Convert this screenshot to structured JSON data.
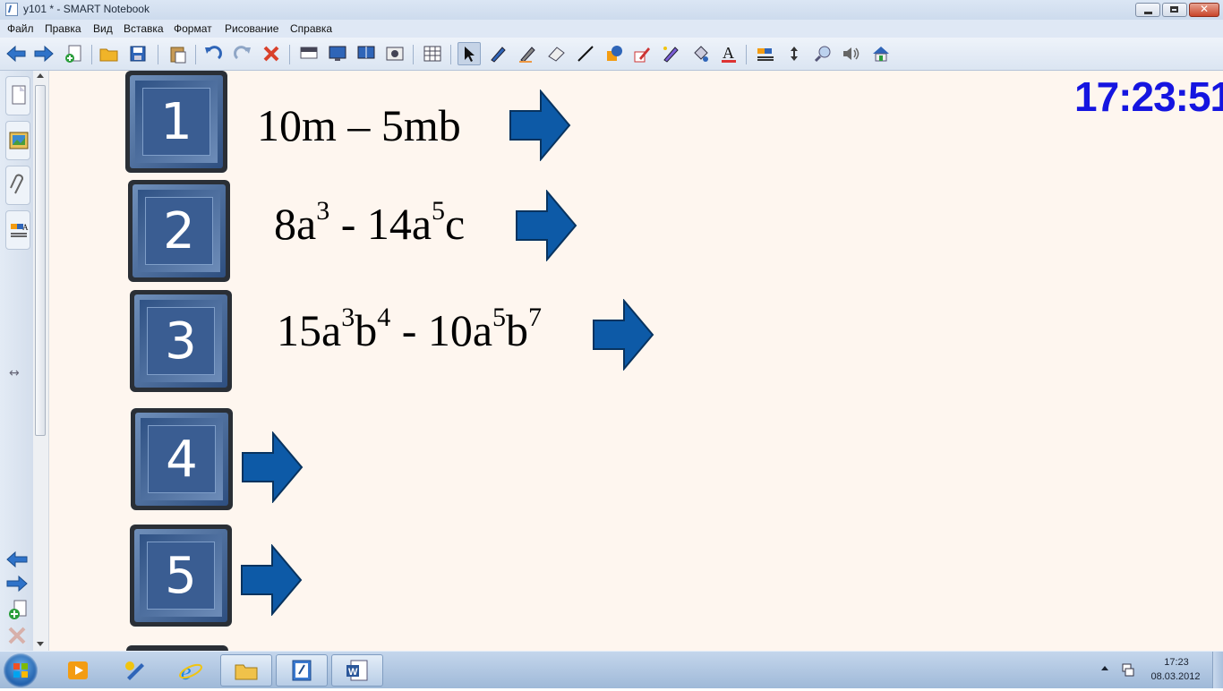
{
  "window": {
    "title": "у101 * - SMART Notebook"
  },
  "menu": [
    "Файл",
    "Правка",
    "Вид",
    "Вставка",
    "Формат",
    "Рисование",
    "Справка"
  ],
  "toolbar": {
    "icons": [
      "back-arrow-icon",
      "forward-arrow-icon",
      "add-page-icon",
      "open-folder-icon",
      "save-icon",
      "paste-icon",
      "undo-icon",
      "redo-icon",
      "delete-icon",
      "screen-shade-icon",
      "full-screen-icon",
      "dual-page-icon",
      "screen-capture-icon",
      "table-icon",
      "select-pointer-icon",
      "pen-icon",
      "creative-pen-icon",
      "eraser-icon",
      "line-icon",
      "shape-icon",
      "magic-pen-icon",
      "shape-recognition-pen-icon",
      "fill-icon",
      "text-icon",
      "properties-icon",
      "move-toolbar-icon",
      "search-icon",
      "audio-icon",
      "home-icon"
    ]
  },
  "slide": {
    "clock": "17:23:51",
    "items": [
      {
        "number": "1",
        "expr": [
          {
            "t": "10m – 5mb"
          }
        ]
      },
      {
        "number": "2",
        "expr": [
          {
            "t": "8a"
          },
          {
            "s": "3"
          },
          {
            "t": " - 14a"
          },
          {
            "s": "5"
          },
          {
            "t": "c"
          }
        ]
      },
      {
        "number": "3",
        "expr": [
          {
            "t": "15a"
          },
          {
            "s": "3"
          },
          {
            "t": "b"
          },
          {
            "s": "4"
          },
          {
            "t": " - 10a"
          },
          {
            "s": "5"
          },
          {
            "t": "b"
          },
          {
            "s": "7"
          }
        ]
      },
      {
        "number": "4",
        "expr": []
      },
      {
        "number": "5",
        "expr": []
      }
    ],
    "colors": {
      "background": "#fef6ef",
      "clock": "#1515e0",
      "arrow": "#0d5aa7",
      "button": "#3a5d92"
    }
  },
  "taskbar": {
    "apps": [
      "media-player-icon",
      "paint-icon",
      "internet-explorer-icon",
      "file-explorer-icon",
      "smart-notebook-icon",
      "word-icon"
    ],
    "time": "17:23",
    "date": "08.03.2012"
  }
}
